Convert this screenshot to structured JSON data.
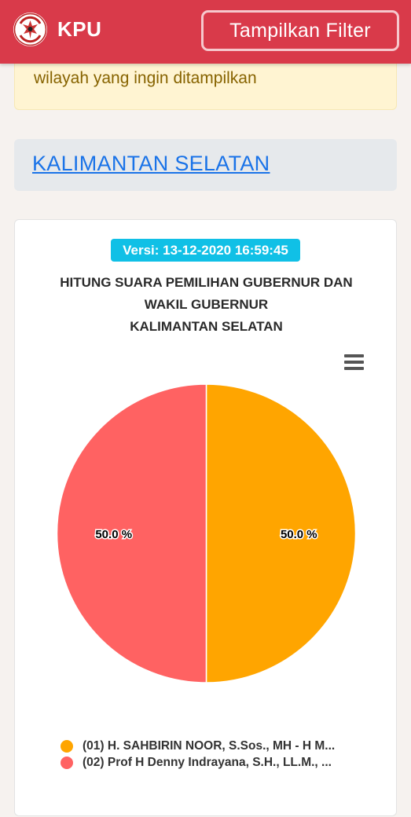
{
  "navbar": {
    "brand": "KPU",
    "filter_button": "Tampilkan Filter"
  },
  "alert": {
    "text": "wilayah yang ingin ditampilkan"
  },
  "region": {
    "link": "KALIMANTAN SELATAN"
  },
  "chart_card": {
    "version": "Versi: 13-12-2020 16:59:45",
    "menu_icon": "hamburger-menu-icon"
  },
  "colors": {
    "navbar": "#d93a4a",
    "badge": "#10c0e6",
    "series_1": "#ffa500",
    "series_2": "#ff6262"
  },
  "chart_data": {
    "type": "pie",
    "title_lines": [
      "HITUNG SUARA PEMILIHAN GUBERNUR DAN",
      "WAKIL GUBERNUR",
      "KALIMANTAN SELATAN"
    ],
    "series": [
      {
        "name": "(01) H. SAHBIRIN NOOR, S.Sos., MH - H M...",
        "value": 50.0,
        "label": "50.0 %",
        "color": "#ffa500"
      },
      {
        "name": "(02) Prof H Denny Indrayana, S.H., LL.M., ...",
        "value": 50.0,
        "label": "50.0 %",
        "color": "#ff6262"
      }
    ],
    "legend_position": "bottom"
  }
}
